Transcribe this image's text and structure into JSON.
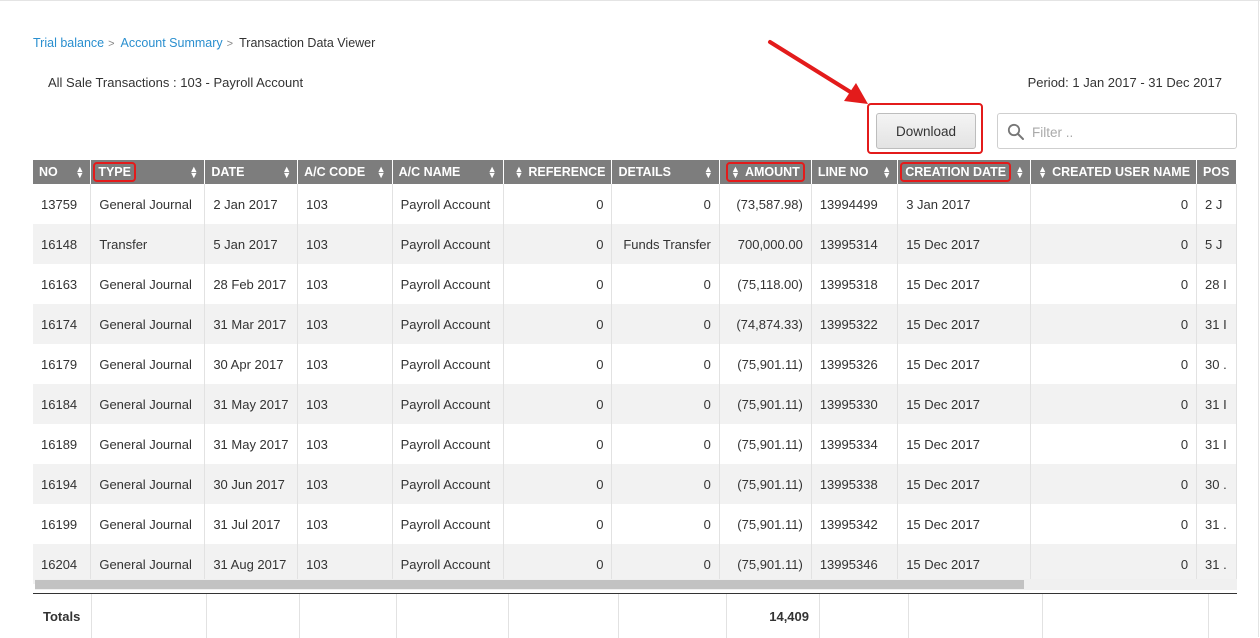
{
  "breadcrumb": {
    "items": [
      "Trial balance",
      "Account Summary"
    ],
    "separator": ">",
    "current": "Transaction Data Viewer"
  },
  "heading": "All Sale Transactions : 103 - Payroll Account",
  "period": "Period: 1 Jan 2017 - 31 Dec 2017",
  "toolbar": {
    "download_label": "Download",
    "filter_placeholder": "Filter .."
  },
  "colors": {
    "header_bg": "#7d7d7d",
    "highlight": "#e31b1b",
    "link": "#2a8fcf",
    "row_alt": "#f2f2f2"
  },
  "table": {
    "columns": [
      "NO",
      "TYPE",
      "DATE",
      "A/C CODE",
      "A/C NAME",
      "REFERENCE",
      "DETAILS",
      "AMOUNT",
      "LINE NO",
      "CREATION DATE",
      "CREATED USER NAME",
      "POS"
    ],
    "rows": [
      [
        "13759",
        "General Journal",
        "2 Jan 2017",
        "103",
        "Payroll Account",
        "0",
        "0",
        "(73,587.98)",
        "13994499",
        "3 Jan 2017",
        "0",
        "2 J"
      ],
      [
        "16148",
        "Transfer",
        "5 Jan 2017",
        "103",
        "Payroll Account",
        "0",
        "Funds Transfer",
        "700,000.00",
        "13995314",
        "15 Dec 2017",
        "0",
        "5 J"
      ],
      [
        "16163",
        "General Journal",
        "28 Feb 2017",
        "103",
        "Payroll Account",
        "0",
        "0",
        "(75,118.00)",
        "13995318",
        "15 Dec 2017",
        "0",
        "28 I"
      ],
      [
        "16174",
        "General Journal",
        "31 Mar 2017",
        "103",
        "Payroll Account",
        "0",
        "0",
        "(74,874.33)",
        "13995322",
        "15 Dec 2017",
        "0",
        "31 I"
      ],
      [
        "16179",
        "General Journal",
        "30 Apr 2017",
        "103",
        "Payroll Account",
        "0",
        "0",
        "(75,901.11)",
        "13995326",
        "15 Dec 2017",
        "0",
        "30 ."
      ],
      [
        "16184",
        "General Journal",
        "31 May 2017",
        "103",
        "Payroll Account",
        "0",
        "0",
        "(75,901.11)",
        "13995330",
        "15 Dec 2017",
        "0",
        "31 I"
      ],
      [
        "16189",
        "General Journal",
        "31 May 2017",
        "103",
        "Payroll Account",
        "0",
        "0",
        "(75,901.11)",
        "13995334",
        "15 Dec 2017",
        "0",
        "31 I"
      ],
      [
        "16194",
        "General Journal",
        "30 Jun 2017",
        "103",
        "Payroll Account",
        "0",
        "0",
        "(75,901.11)",
        "13995338",
        "15 Dec 2017",
        "0",
        "30 ."
      ],
      [
        "16199",
        "General Journal",
        "31 Jul 2017",
        "103",
        "Payroll Account",
        "0",
        "0",
        "(75,901.11)",
        "13995342",
        "15 Dec 2017",
        "0",
        "31 ."
      ],
      [
        "16204",
        "General Journal",
        "31 Aug 2017",
        "103",
        "Payroll Account",
        "0",
        "0",
        "(75,901.11)",
        "13995346",
        "15 Dec 2017",
        "0",
        "31 ."
      ]
    ]
  },
  "totals": {
    "label": "Totals",
    "amount": "14,409"
  }
}
